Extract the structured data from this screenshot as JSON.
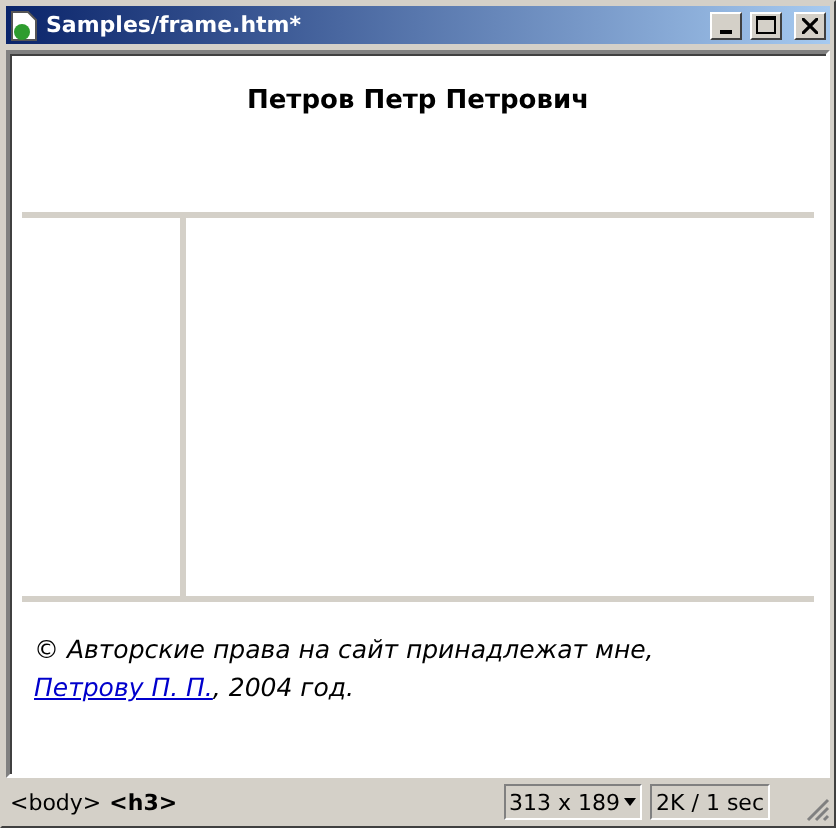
{
  "window": {
    "title": "Samples/frame.htm*"
  },
  "top_frame": {
    "heading": "Петров Петр Петрович"
  },
  "footer": {
    "text_before": "© Авторские права на сайт принадлежат мне,",
    "link": "Петрову П. П.",
    "text_after": ", 2004 год."
  },
  "status_bar": {
    "tags": [
      {
        "label": "<body>",
        "selected": false
      },
      {
        "label": "<h3>",
        "selected": true
      }
    ],
    "window_size": "313 x 189",
    "download": "2K / 1 sec"
  }
}
